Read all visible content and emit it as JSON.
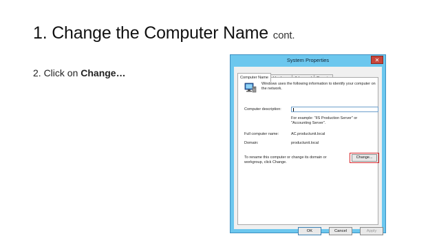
{
  "slide": {
    "title": "1. Change the Computer Name",
    "title_suffix": "cont.",
    "step_prefix": "2. Click on ",
    "step_bold": "Change…"
  },
  "window": {
    "title": "System Properties",
    "close_glyph": "✕",
    "tabs": [
      {
        "label": "Computer Name",
        "active": true
      },
      {
        "label": "Hardware",
        "active": false
      },
      {
        "label": "Advanced",
        "active": false
      },
      {
        "label": "Remote",
        "active": false
      }
    ],
    "intro": "Windows uses the following information to identify your computer on the network.",
    "description_label": "Computer description:",
    "description_value": "",
    "example": "For example: \"IIS Production Server\" or \"Accounting Server\".",
    "full_name_label": "Full computer name:",
    "full_name_value": "AC.productunit.local",
    "domain_label": "Domain:",
    "domain_value": "productunit.local",
    "rename_text": "To rename this computer or change its domain or workgroup, click Change.",
    "change_button": "Change...",
    "ok_button": "OK",
    "cancel_button": "Cancel",
    "apply_button": "Apply",
    "highlight_color": "#d7262b",
    "icon": "computer-network-icon"
  }
}
